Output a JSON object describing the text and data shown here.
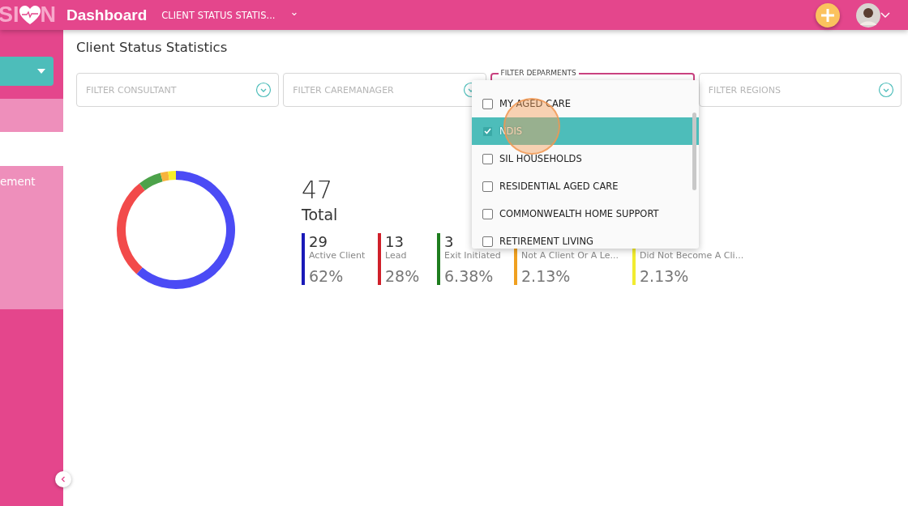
{
  "header": {
    "logo_left": "SI",
    "logo_right": "N",
    "title": "Dashboard",
    "breadcrumb": "CLIENT STATUS STATIS...",
    "breadcrumb_caret": "⌄"
  },
  "sidebar": {
    "items": [
      {
        "kind": "dropdown",
        "selected": false
      },
      {
        "kind": "block",
        "selected": false
      },
      {
        "kind": "block",
        "selected": true
      },
      {
        "kind": "text",
        "label": "ement",
        "selected": false
      }
    ]
  },
  "page_title": "Client Status Statistics",
  "filters": [
    {
      "placeholder": "FILTER CONSULTANT",
      "focused": false
    },
    {
      "placeholder": "FILTER CAREMANAGER",
      "focused": false
    },
    {
      "label": "FILTER DEPARMENTS",
      "focused": true
    },
    {
      "placeholder": "FILTER REGIONS",
      "focused": false
    }
  ],
  "departments_menu": {
    "options": [
      {
        "label": "MY AGED CARE",
        "checked": false,
        "selected": false
      },
      {
        "label": "NDIS",
        "checked": true,
        "selected": true
      },
      {
        "label": "SIL HOUSEHOLDS",
        "checked": false,
        "selected": false
      },
      {
        "label": "RESIDENTIAL AGED CARE",
        "checked": false,
        "selected": false
      },
      {
        "label": "COMMONWEALTH HOME SUPPORT",
        "checked": false,
        "selected": false
      },
      {
        "label": "RETIREMENT LIVING",
        "checked": false,
        "selected": false
      }
    ]
  },
  "summary": {
    "total": "47",
    "total_label": "Total",
    "chart_data": {
      "type": "donut",
      "categories": [
        "Active Client",
        "Lead",
        "Exit Initiated",
        "Not A Client Or A Le...",
        "Did Not Become A Cli..."
      ],
      "values": [
        62,
        28,
        6.38,
        2.13,
        2.13
      ],
      "colors": [
        "#4b4bf5",
        "#f24a4a",
        "#4ca24a",
        "#f7b33c",
        "#f7ef2a"
      ]
    },
    "legend": [
      {
        "count": "29",
        "percent": "62%",
        "color": "#1a1ab8"
      },
      {
        "count": "13",
        "percent": "28%",
        "color": "#d0202a"
      },
      {
        "count": "3",
        "percent": "6.38%",
        "color": "#1e7d1e"
      },
      {
        "percent": "2.13%",
        "color": "#f0a020"
      },
      {
        "percent": "2.13%",
        "color": "#f2ec30"
      }
    ]
  }
}
